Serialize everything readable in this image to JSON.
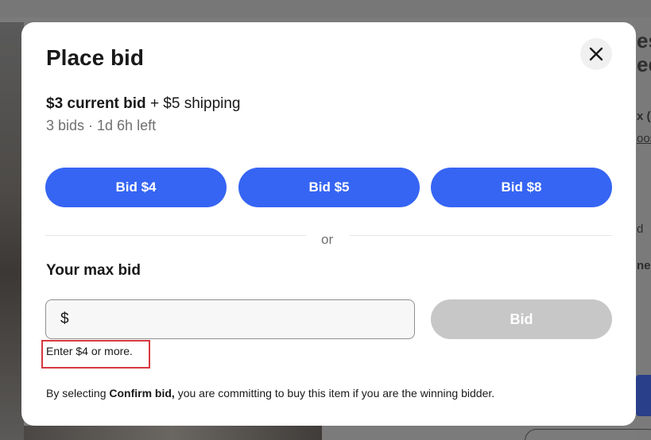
{
  "background": {
    "right_text_lines": [
      "es",
      "ed",
      "x (",
      "oos",
      "d",
      "ned"
    ]
  },
  "modal": {
    "title": "Place bid",
    "close_icon": "close-icon",
    "current_bid": "$3 current bid",
    "shipping": "+ $5 shipping",
    "meta": "3 bids · 1d 6h left",
    "quick_bids": [
      {
        "label": "Bid $4"
      },
      {
        "label": "Bid $5"
      },
      {
        "label": "Bid $8"
      }
    ],
    "or_label": "or",
    "max_bid_label": "Your max bid",
    "currency_symbol": "$",
    "max_bid_value": "",
    "bid_button_label": "Bid",
    "hint": "Enter $4 or more.",
    "footer": {
      "prefix": "By selecting",
      "emphasis": "Confirm bid,",
      "suffix": "you are committing to buy this item if you are the winning bidder."
    }
  },
  "colors": {
    "primary": "#3665f3",
    "disabled": "#c7c7c7",
    "highlight_border": "#d6383e",
    "overlay": "#7b7b7b"
  }
}
